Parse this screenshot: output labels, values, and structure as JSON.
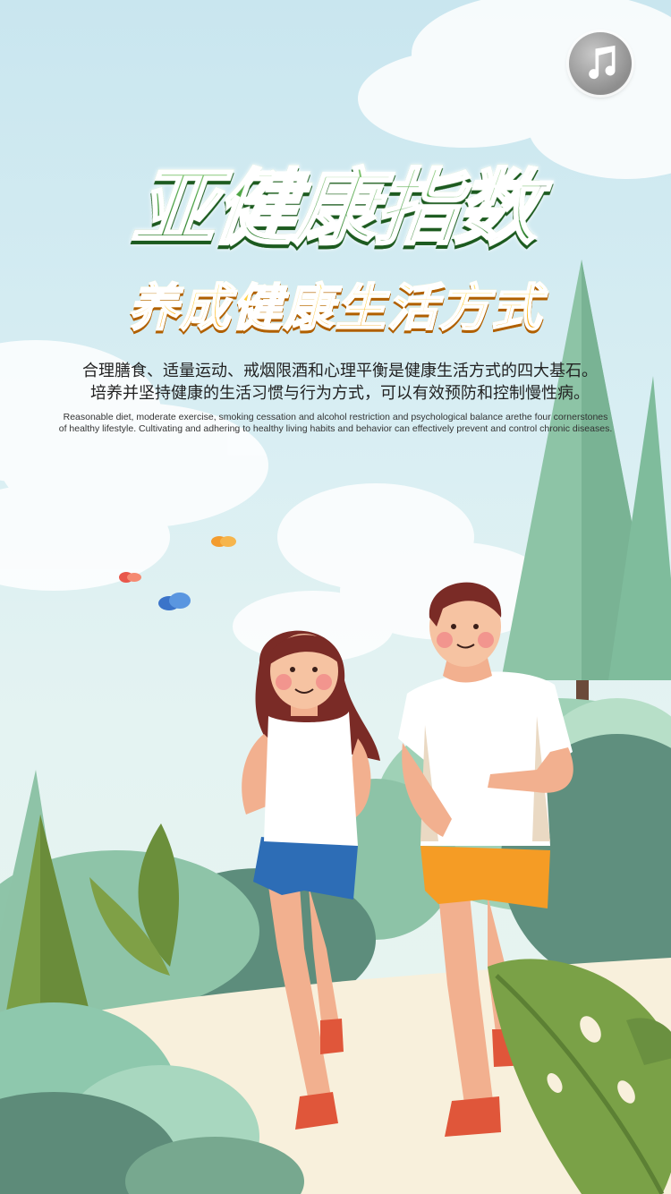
{
  "header": {
    "title": "亚健康指数",
    "subtitle": "养成健康生活方式"
  },
  "description": {
    "cn_line1": "合理膳食、适量运动、戒烟限酒和心理平衡是健康生活方式的四大基石。",
    "cn_line2": "培养并坚持健康的生活习惯与行为方式，可以有效预防和控制慢性病。",
    "en_line1": "Reasonable diet, moderate exercise, smoking cessation and alcohol restriction and psychological balance arethe four cornerstones",
    "en_line2": "of healthy lifestyle. Cultivating and adhering to healthy living habits and behavior can effectively prevent and control chronic diseases."
  },
  "controls": {
    "music_icon": "music-note-icon"
  },
  "colors": {
    "sky": "#cfe8f0",
    "title_green": "#2f8d2c",
    "subtitle_orange": "#ffb300",
    "tree_green": "#8cc3a6",
    "dark_green": "#5f8b7a",
    "path": "#f8f0dc"
  }
}
